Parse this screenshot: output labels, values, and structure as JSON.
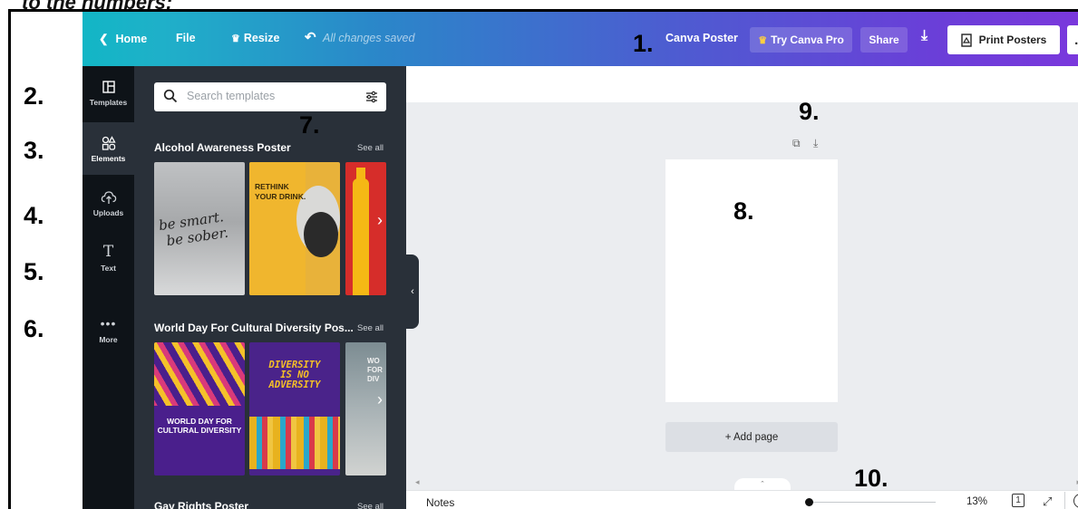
{
  "caption": "to the numbers:",
  "topbar": {
    "home": "Home",
    "file": "File",
    "resize": "Resize",
    "saved": "All changes saved",
    "design_name": "Canva Poster",
    "try_pro": "Try Canva Pro",
    "share": "Share",
    "print": "Print Posters",
    "more": "…"
  },
  "sidebar": {
    "items": [
      {
        "label": "Templates",
        "icon": "templates-icon"
      },
      {
        "label": "Elements",
        "icon": "elements-icon"
      },
      {
        "label": "Uploads",
        "icon": "upload-cloud-icon"
      },
      {
        "label": "Text",
        "icon": "text-icon"
      },
      {
        "label": "More",
        "icon": "more-dots-icon"
      }
    ]
  },
  "panel": {
    "search_placeholder": "Search templates",
    "see_all": "See all",
    "sections": [
      {
        "title": "Alcohol Awareness Poster",
        "thumbs": [
          {
            "line1": "be smart.",
            "line2": "be sober."
          },
          {
            "line1": "RETHINK",
            "line2": "YOUR DRINK."
          }
        ]
      },
      {
        "title": "World Day For Cultural Diversity Pos...",
        "thumbs": [
          {
            "line1": "WORLD DAY FOR",
            "line2": "CULTURAL DIVERSITY"
          },
          {
            "line1": "DIVERSITY",
            "line2": "IS NO",
            "line3": "ADVERSITY"
          },
          {
            "line1": "WO",
            "line2": "FOR",
            "line3": "DIV"
          }
        ]
      },
      {
        "title": "Gay Rights Poster"
      }
    ]
  },
  "canvas": {
    "add_page": "+ Add page"
  },
  "bottombar": {
    "notes": "Notes",
    "zoom": "13%",
    "page_count": "1"
  },
  "annotations": {
    "n1": "1.",
    "n2": "2.",
    "n3": "3.",
    "n4": "4.",
    "n5": "5.",
    "n6": "6.",
    "n7": "7.",
    "n8": "8.",
    "n9": "9.",
    "n10": "10."
  },
  "colors": {
    "topbar_start": "#12b6c6",
    "topbar_end": "#7a38dc",
    "rail": "#0e1318",
    "panel": "#293039",
    "canvas_bg": "#ebedf0",
    "crown": "#ffcf3f"
  }
}
